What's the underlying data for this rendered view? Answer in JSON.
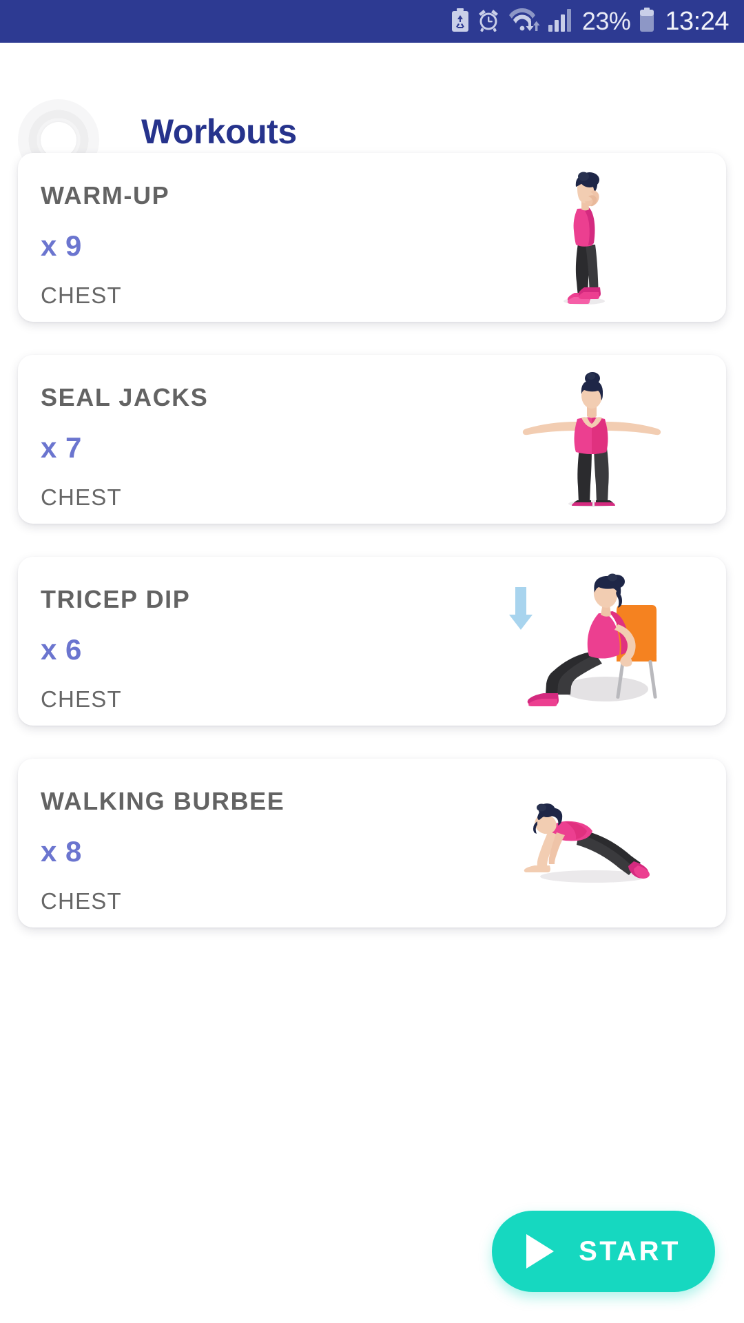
{
  "status_bar": {
    "background": "#2d3a92",
    "battery_percent": "23%",
    "time": "13:24",
    "icons": [
      "battery-saver-icon",
      "alarm-clock-icon",
      "wifi-icon",
      "signal-bars-icon",
      "battery-icon"
    ]
  },
  "header": {
    "title": "Workouts",
    "title_color": "#26338c",
    "back_label": "back-button"
  },
  "workouts": [
    {
      "name": "WARM-UP",
      "reps": "x 9",
      "muscle_group": "CHEST",
      "pose": "standing-side-pose"
    },
    {
      "name": "SEAL JACKS",
      "reps": "x 7",
      "muscle_group": "CHEST",
      "pose": "arms-out-front-pose"
    },
    {
      "name": "TRICEP DIP",
      "reps": "x 6",
      "muscle_group": "CHEST",
      "pose": "chair-dip-pose"
    },
    {
      "name": "WALKING BURBEE",
      "reps": "x 8",
      "muscle_group": "CHEST",
      "pose": "plank-pose"
    }
  ],
  "start_button": {
    "label": "START",
    "color": "#16d8c0",
    "icon": "play-icon"
  },
  "theme": {
    "reps_color": "#6b75cf",
    "name_color": "#636363",
    "group_color": "#666666",
    "card_background": "#ffffff",
    "page_background": "#ffffff",
    "accent_pink": "#e8368f",
    "accent_navy": "#26338c"
  }
}
